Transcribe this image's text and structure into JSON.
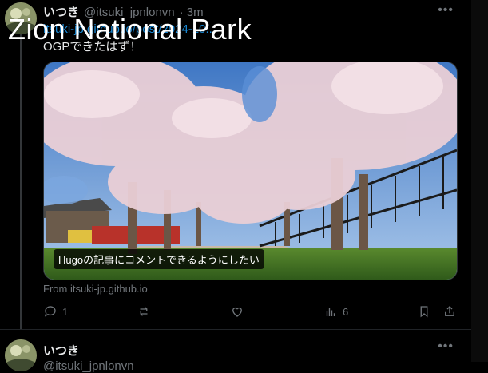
{
  "post": {
    "author_name": "いつき",
    "author_handle": "@itsuki_jpnlonvn",
    "timestamp": "· 3m",
    "link_partial": "itsuki-jp.github.io/post/2024-10...",
    "text": "OGPできたはず！",
    "card_caption": "Hugoの記事にコメントできるようにしたい",
    "card_source": "From itsuki-jp.github.io",
    "actions": {
      "reply_count": "1",
      "repost_count": "",
      "like_count": "",
      "views_count": "6"
    }
  },
  "overlay": {
    "title": "Zion National Park"
  },
  "post2": {
    "author_name": "いつき",
    "author_handle": "@itsuki_jpnlonvn"
  },
  "icons": {
    "more": "more-horizontal-icon",
    "reply": "reply-icon",
    "repost": "repost-icon",
    "like": "heart-icon",
    "views": "views-icon",
    "bookmark": "bookmark-icon",
    "share": "share-icon"
  },
  "colors": {
    "background": "#000000",
    "text": "#e7e9ea",
    "muted": "#71767b",
    "link": "#1d9bf0"
  }
}
